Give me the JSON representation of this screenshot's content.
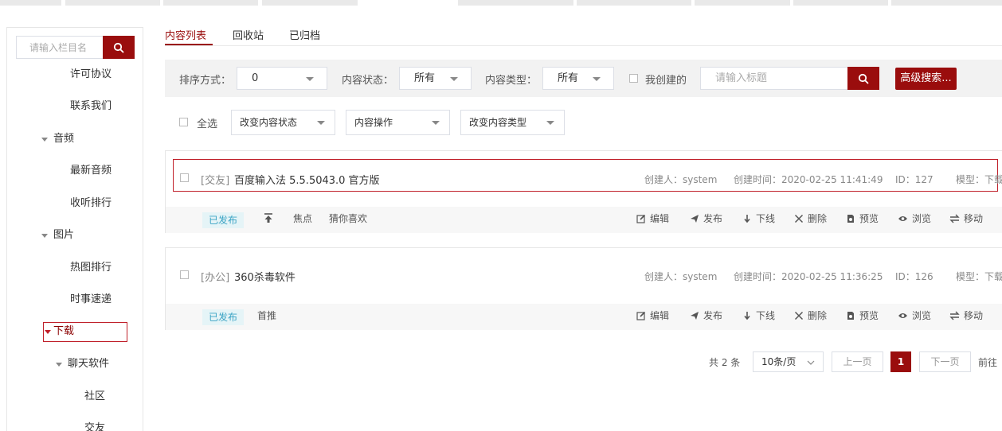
{
  "colors": {
    "accent": "#9a0d0d",
    "highlight_border": "#c0202a",
    "badge_bg": "#e5f4f7",
    "badge_text": "#3aa3c4"
  },
  "sidebar": {
    "search_placeholder": "请输入栏目名",
    "items": [
      {
        "label": "许可协议",
        "expandable": false
      },
      {
        "label": "联系我们",
        "expandable": false
      },
      {
        "label": "音频",
        "expandable": true
      },
      {
        "label": "最新音频",
        "expandable": false
      },
      {
        "label": "收听排行",
        "expandable": false
      },
      {
        "label": "图片",
        "expandable": true
      },
      {
        "label": "热图排行",
        "expandable": false
      },
      {
        "label": "时事速递",
        "expandable": false
      },
      {
        "label": "下载",
        "expandable": true,
        "selected": true
      },
      {
        "label": "聊天软件",
        "expandable": true
      },
      {
        "label": "社区",
        "expandable": false
      },
      {
        "label": "交友",
        "expandable": false
      }
    ]
  },
  "tabs": [
    {
      "label": "内容列表",
      "active": true
    },
    {
      "label": "回收站",
      "active": false
    },
    {
      "label": "已归档",
      "active": false
    }
  ],
  "filters": {
    "sort_label": "排序方式：",
    "sort_value": "0",
    "status_label": "内容状态：",
    "status_value": "所有",
    "type_label": "内容类型：",
    "type_value": "所有",
    "mine_label": "我创建的",
    "title_placeholder": "请输入标题",
    "advanced_label": "高级搜索..."
  },
  "bulk": {
    "select_all": "全选",
    "change_status": "改变内容状态",
    "content_ops": "内容操作",
    "change_type": "改变内容类型"
  },
  "items": [
    {
      "category": "[交友]",
      "title": "百度输入法 5.5.5043.0 官方版",
      "creator": "创建人：system",
      "created": "创建时间：2020-02-25 11:41:49",
      "id": "ID：127",
      "model": "模型：下载",
      "status": "已发布",
      "tags": [
        "焦点",
        "猜你喜欢"
      ]
    },
    {
      "category": "[办公]",
      "title": "360杀毒软件",
      "creator": "创建人：system",
      "created": "创建时间：2020-02-25 11:36:25",
      "id": "ID：126",
      "model": "模型：下载",
      "status": "已发布",
      "tags": [
        "首推"
      ]
    }
  ],
  "actions": [
    "编辑",
    "发布",
    "下线",
    "删除",
    "预览",
    "浏览",
    "移动"
  ],
  "pagination": {
    "total": "共 2 条",
    "page_size": "10条/页",
    "prev": "上一页",
    "current": "1",
    "next": "下一页",
    "goto": "前往"
  }
}
